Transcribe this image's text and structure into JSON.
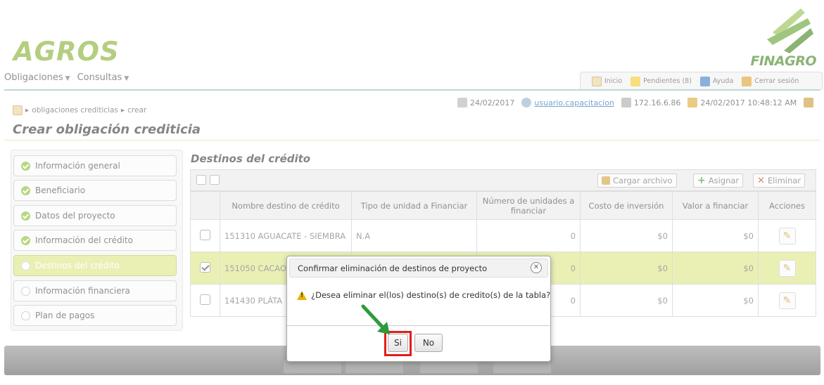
{
  "header": {
    "app_name": "AGROS",
    "brand": "FINAGRO",
    "menu": [
      {
        "label": "Obligaciones"
      },
      {
        "label": "Consultas"
      }
    ],
    "toolbar": {
      "inicio": "Inicio",
      "pendientes": "Pendientes (8)",
      "ayuda": "Ayuda",
      "cerrar": "Cerrar sesión"
    }
  },
  "status": {
    "date": "24/02/2017",
    "user": "usuario.capacitacion",
    "ip": "172.16.6.86",
    "datetime": "24/02/2017 10:48:12 AM"
  },
  "breadcrumb": {
    "item1": "obligaciones crediticias",
    "item2": "crear"
  },
  "page_title": "Crear obligación crediticia",
  "wizard": {
    "steps": [
      {
        "label": "Información general",
        "state": "done"
      },
      {
        "label": "Beneficiario",
        "state": "done"
      },
      {
        "label": "Datos del proyecto",
        "state": "done"
      },
      {
        "label": "Información del crédito",
        "state": "done"
      },
      {
        "label": "Destinos del crédito",
        "state": "active"
      },
      {
        "label": "Información financiera",
        "state": "pending"
      },
      {
        "label": "Plan de pagos",
        "state": "pending"
      }
    ]
  },
  "section_title": "Destinos del crédito",
  "grid_toolbar": {
    "cargar": "Cargar archivo",
    "asignar": "Asignar",
    "eliminar": "Eliminar"
  },
  "table": {
    "columns": [
      "Nombre destino de crédito",
      "Tipo de unidad a Financiar",
      "Número de unidades a financiar",
      "Costo de inversión",
      "Valor a financiar",
      "Acciones"
    ],
    "rows": [
      {
        "nombre": "151310 AGUACATE - SIEMBRA",
        "tipo": "N.A",
        "unidades": "0",
        "costo": "$0",
        "valor": "$0",
        "checked": false
      },
      {
        "nombre": "151050 CACAO",
        "tipo": "",
        "unidades": "0",
        "costo": "$0",
        "valor": "$0",
        "checked": true
      },
      {
        "nombre": "141430 PLÁTA",
        "tipo": "",
        "unidades": "0",
        "costo": "$0",
        "valor": "$0",
        "checked": false
      }
    ]
  },
  "modal": {
    "title": "Confirmar eliminación de destinos de proyecto",
    "message": "¿Desea eliminar el(los) destino(s) de credito(s) de la tabla?",
    "yes": "Si",
    "no": "No"
  },
  "colors": {
    "accent": "#8cb43c",
    "selected_row": "#dfe88d",
    "highlight": "#e41b1b",
    "arrow": "#2e9a3a"
  }
}
